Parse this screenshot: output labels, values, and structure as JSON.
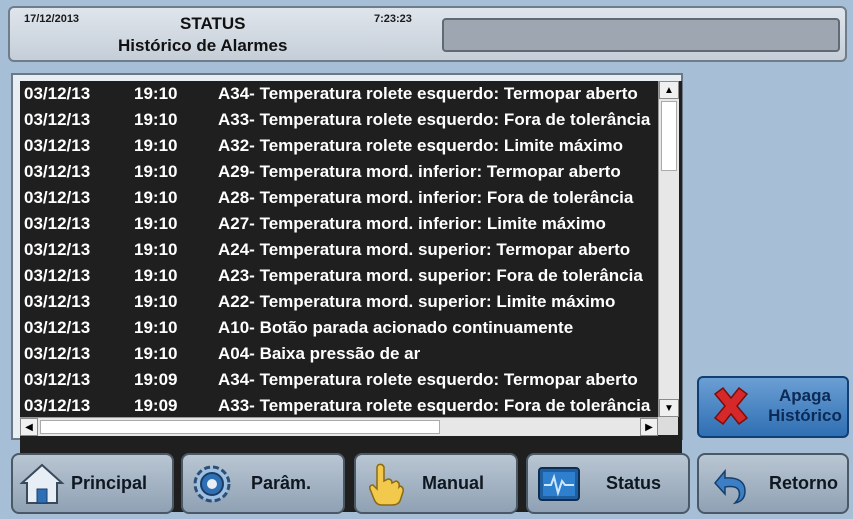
{
  "header": {
    "date": "17/12/2013",
    "title": "STATUS",
    "subtitle": "Histórico de Alarmes",
    "time": "7:23:23"
  },
  "alarms": [
    {
      "date": "03/12/13",
      "time": "19:10",
      "message": "A34- Temperatura rolete esquerdo: Termopar aberto"
    },
    {
      "date": "03/12/13",
      "time": "19:10",
      "message": "A33- Temperatura rolete esquerdo: Fora de tolerância"
    },
    {
      "date": "03/12/13",
      "time": "19:10",
      "message": "A32- Temperatura rolete esquerdo: Limite máximo"
    },
    {
      "date": "03/12/13",
      "time": "19:10",
      "message": "A29- Temperatura mord. inferior: Termopar aberto"
    },
    {
      "date": "03/12/13",
      "time": "19:10",
      "message": "A28- Temperatura mord. inferior: Fora de tolerância"
    },
    {
      "date": "03/12/13",
      "time": "19:10",
      "message": "A27- Temperatura mord. inferior: Limite máximo"
    },
    {
      "date": "03/12/13",
      "time": "19:10",
      "message": "A24- Temperatura mord. superior: Termopar aberto"
    },
    {
      "date": "03/12/13",
      "time": "19:10",
      "message": "A23- Temperatura mord. superior: Fora de tolerância"
    },
    {
      "date": "03/12/13",
      "time": "19:10",
      "message": "A22- Temperatura mord. superior: Limite máximo"
    },
    {
      "date": "03/12/13",
      "time": "19:10",
      "message": "A10- Botão parada acionado continuamente"
    },
    {
      "date": "03/12/13",
      "time": "19:10",
      "message": "A04- Baixa pressão de ar"
    },
    {
      "date": "03/12/13",
      "time": "19:09",
      "message": "A34- Temperatura rolete esquerdo: Termopar aberto"
    },
    {
      "date": "03/12/13",
      "time": "19:09",
      "message": "A33- Temperatura rolete esquerdo: Fora de tolerância"
    }
  ],
  "apaga_button": {
    "line1": "Apaga",
    "line2": "Histórico"
  },
  "nav": {
    "principal": "Principal",
    "param": "Parâm.",
    "manual": "Manual",
    "status": "Status",
    "retorno": "Retorno"
  },
  "colors": {
    "background": "#a7bfd6",
    "list_bg": "#1f1f1f",
    "list_text": "#ffffff",
    "accent_blue": "#2f6fb4",
    "delete_red": "#d62828"
  },
  "icons": {
    "principal": "home-icon",
    "param": "gear-icon",
    "manual": "hand-icon",
    "status": "monitor-icon",
    "retorno": "return-arrow-icon",
    "apaga": "red-x-icon"
  }
}
